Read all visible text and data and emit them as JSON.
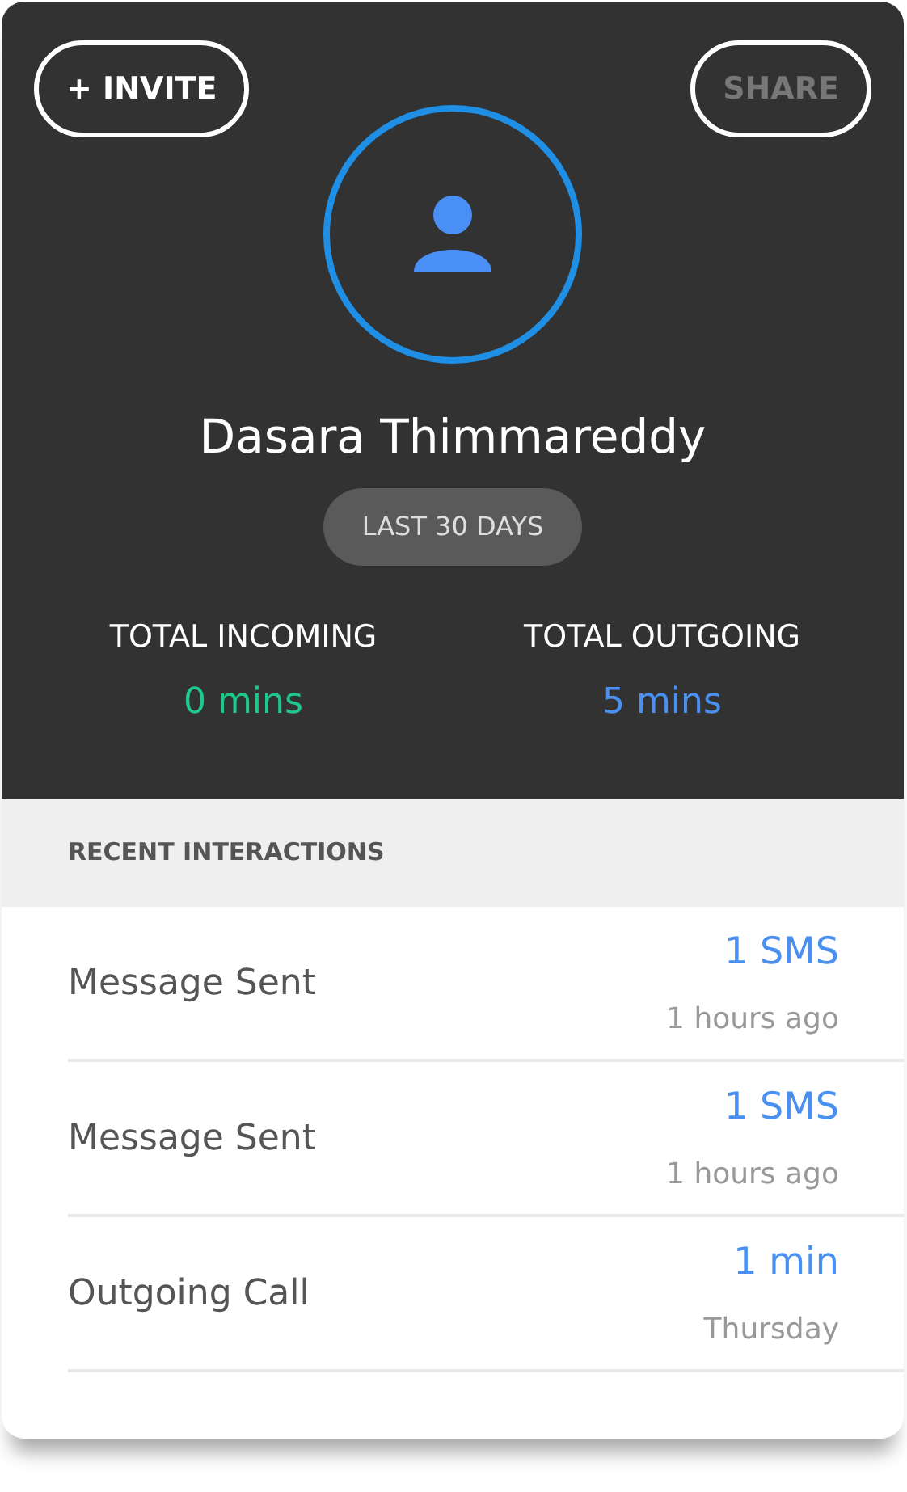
{
  "header": {
    "buttons": [
      {
        "label": "+ INVITE",
        "disabled": false
      },
      {
        "label": "SHARE",
        "disabled": true
      }
    ],
    "name": "Dasara Thimmareddy",
    "period": "LAST 30 DAYS",
    "totals": [
      {
        "label": "TOTAL INCOMING",
        "value": "0 mins",
        "color": "#1ec98b"
      },
      {
        "label": "TOTAL OUTGOING",
        "value": "5 mins",
        "color": "#4a90f0"
      }
    ]
  },
  "recent": {
    "title": "RECENT INTERACTIONS",
    "items": [
      {
        "label": "Message Sent",
        "amount": "1 SMS",
        "time": "1 hours ago"
      },
      {
        "label": "Message Sent",
        "amount": "1 SMS",
        "time": "1 hours ago"
      },
      {
        "label": "Outgoing Call",
        "amount": "1 min",
        "time": "Thursday"
      }
    ]
  }
}
